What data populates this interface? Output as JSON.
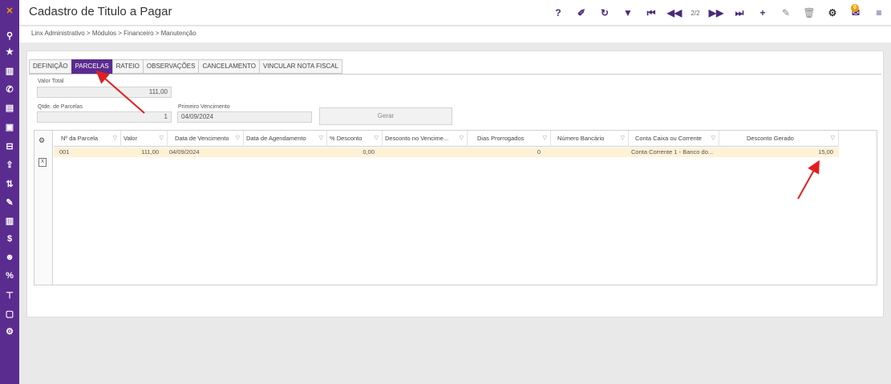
{
  "header": {
    "title": "Cadastro de Titulo a Pagar",
    "page_indicator": "2/2",
    "notification_count": "0"
  },
  "breadcrumb": "Linx Administrativo  >  Módulos  >  Financeiro  >  Manutenção",
  "tabs": [
    {
      "label": "DEFINIÇÃO"
    },
    {
      "label": "PARCELAS"
    },
    {
      "label": "RATEIO"
    },
    {
      "label": "OBSERVAÇÕES"
    },
    {
      "label": "CANCELAMENTO"
    },
    {
      "label": "VINCULAR NOTA FISCAL"
    }
  ],
  "form": {
    "valor_total_label": "Valor Total",
    "valor_total_value": "111,00",
    "qtde_parcelas_label": "Qtde. de Parcelas",
    "qtde_parcelas_value": "1",
    "primeiro_venc_label": "Primeiro Vencimento",
    "primeiro_venc_value": "04/09/2024",
    "gerar_label": "Gerar"
  },
  "grid": {
    "columns": [
      "Nº da Parcela",
      "Valor",
      "Data de Vencimento",
      "Data de Agendamento",
      "% Desconto",
      "Desconto no Vencime...",
      "Dias Prorrogados",
      "Número Bancário",
      "Conta Caixa ou Corrente",
      "Desconto Gerado"
    ],
    "rows": [
      {
        "parcela": "001",
        "valor": "111,00",
        "vencimento": "04/09/2024",
        "agendamento": "",
        "perc_desconto": "0,00",
        "desconto_venc": "",
        "dias_prorrogados": "0",
        "numero_bancario": "",
        "conta": "Conta Corrente 1 - Banco do...",
        "desconto_gerado": "15,00"
      }
    ]
  },
  "colors": {
    "brand": "#5b2c8f",
    "row_highlight": "#fdf1d6",
    "annotation": "#e02020"
  }
}
